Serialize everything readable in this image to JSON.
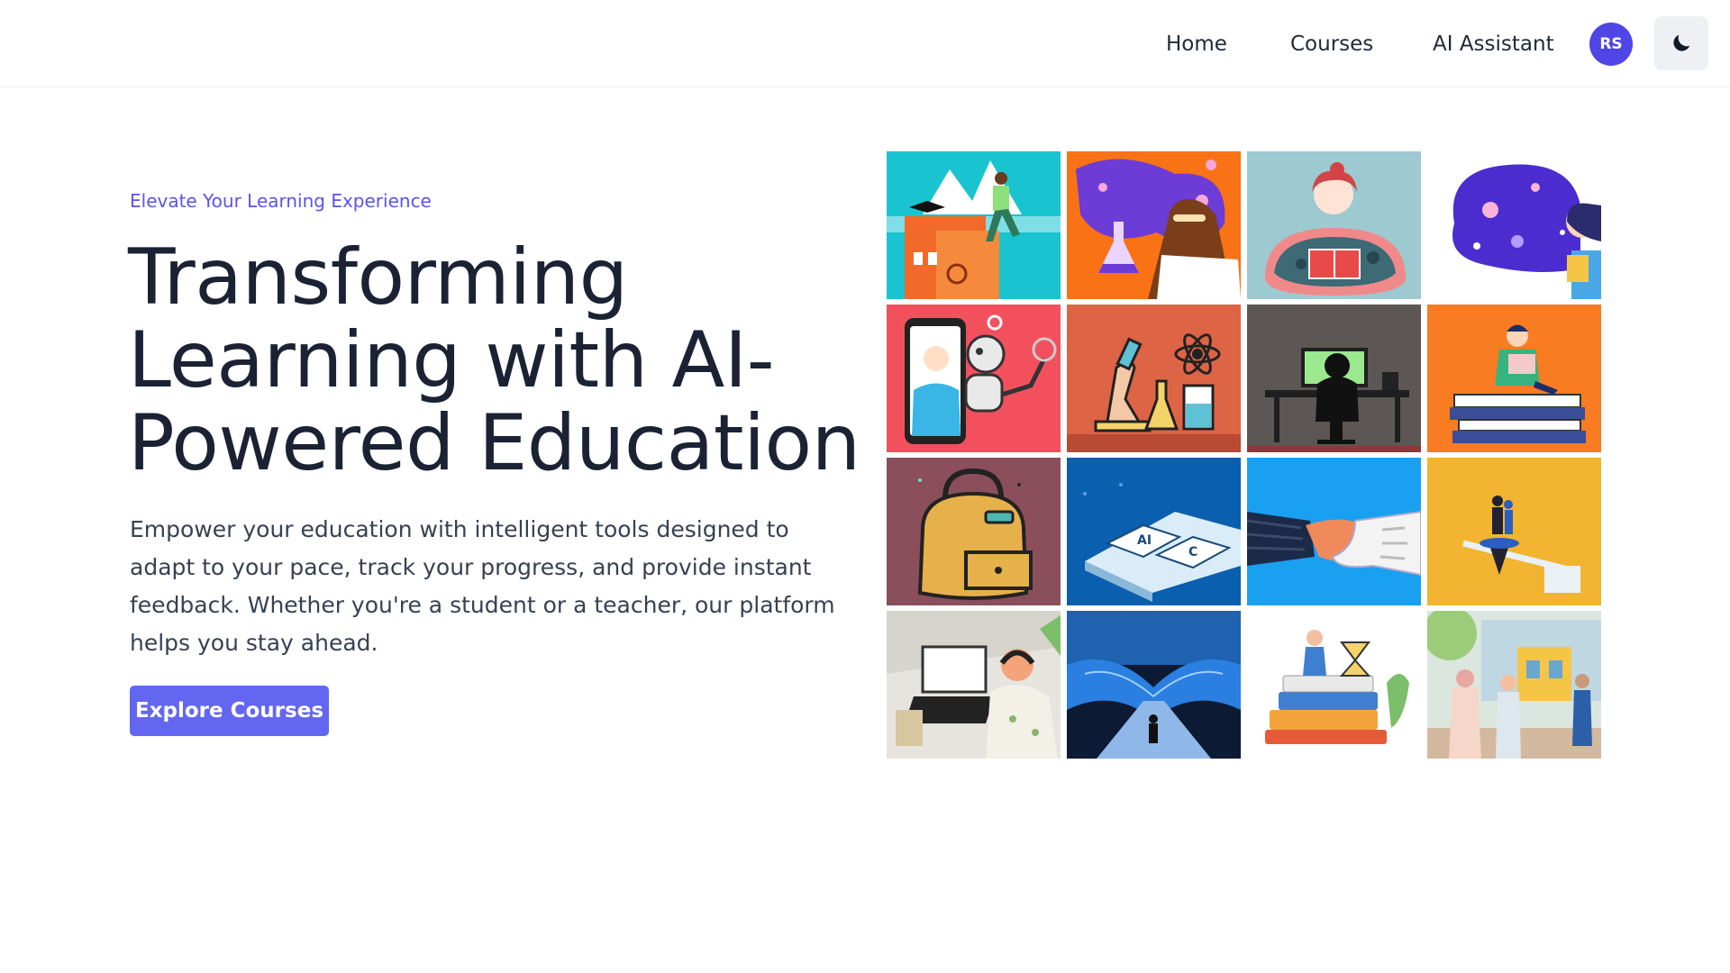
{
  "nav": {
    "home": "Home",
    "courses": "Courses",
    "ai_assistant": "AI Assistant",
    "avatar_initials": "RS",
    "theme_toggle_icon": "moon-icon"
  },
  "hero": {
    "tagline": "Elevate Your Learning Experience",
    "headline_line1": "Transforming",
    "headline_line2": "Learning with AI-",
    "headline_line3": "Powered Education",
    "description": "Empower your education with intelligent tools designed to adapt to your pace, track your progress, and provide instant feedback. Whether you're a student or a teacher, our platform helps you stay ahead.",
    "cta_label": "Explore Courses"
  },
  "colors": {
    "accent": "#6366f1",
    "avatar_bg": "#4f46e5",
    "headline": "#1a2233"
  },
  "gallery": {
    "tiles": [
      {
        "name": "graduate-climbing-illustration",
        "bg": "#19c3cf"
      },
      {
        "name": "chemistry-student-illustration",
        "bg": "#f97316"
      },
      {
        "name": "woman-reading-book-illustration",
        "bg": "#9ccad0"
      },
      {
        "name": "space-reader-illustration",
        "bg": "#ffffff"
      },
      {
        "name": "robot-video-call-illustration",
        "bg": "#f3505e"
      },
      {
        "name": "lab-equipment-illustration",
        "bg": "#de6446"
      },
      {
        "name": "student-at-computer-illustration",
        "bg": "#5c5754"
      },
      {
        "name": "student-on-books-illustration",
        "bg": "#f97b22"
      },
      {
        "name": "backpack-illustration",
        "bg": "#8a4f5b"
      },
      {
        "name": "ai-keyboard-illustration",
        "bg": "#0a5fae"
      },
      {
        "name": "human-robot-handshake-illustration",
        "bg": "#1aa0f0"
      },
      {
        "name": "balance-scale-illustration",
        "bg": "#f2b431"
      },
      {
        "name": "online-class-laptop-illustration",
        "bg": "#e7e4df"
      },
      {
        "name": "open-book-path-illustration",
        "bg": "#0c1a33"
      },
      {
        "name": "books-hourglass-illustration",
        "bg": "#ffffff"
      },
      {
        "name": "students-at-school-illustration",
        "bg": "#dbe6de"
      }
    ]
  }
}
